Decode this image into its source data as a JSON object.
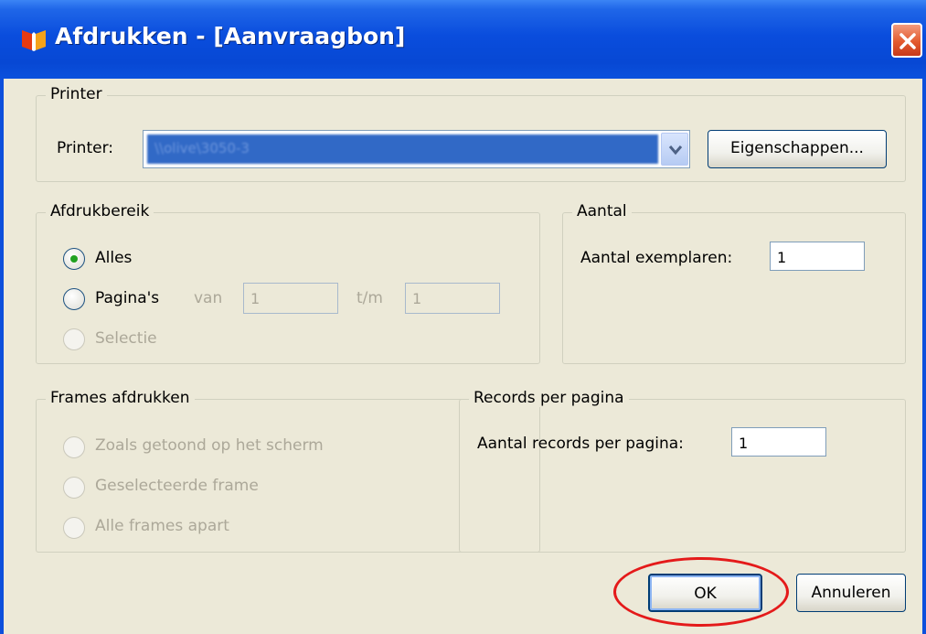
{
  "window": {
    "title": "Afdrukken - [Aanvraagbon]"
  },
  "printer_group": {
    "title": "Printer",
    "printer_label": "Printer:",
    "selected_printer": "\\\\olive\\3050-3",
    "properties_button": "Eigenschappen..."
  },
  "range_group": {
    "title": "Afdrukbereik",
    "options": [
      {
        "label": "Alles",
        "checked": true,
        "enabled": true
      },
      {
        "label": "Pagina's",
        "checked": false,
        "enabled": true
      },
      {
        "label": "Selectie",
        "checked": false,
        "enabled": false
      }
    ],
    "from_label": "van",
    "from_value": "1",
    "to_label": "t/m",
    "to_value": "1"
  },
  "count_group": {
    "title": "Aantal",
    "copies_label": "Aantal exemplaren:",
    "copies_value": "1"
  },
  "frames_group": {
    "title": "Frames afdrukken",
    "options": [
      {
        "label": "Zoals getoond op het scherm",
        "enabled": false
      },
      {
        "label": "Geselecteerde frame",
        "enabled": false
      },
      {
        "label": "Alle frames apart",
        "enabled": false
      }
    ]
  },
  "records_group": {
    "title": "Records per pagina",
    "records_label": "Aantal records per pagina:",
    "records_value": "1"
  },
  "buttons": {
    "ok": "OK",
    "cancel": "Annuleren"
  },
  "colors": {
    "titlebar": "#0a4ddd",
    "dialog_bg": "#ece9d8",
    "highlight_circle": "#e41a1a",
    "radio_checked_dot": "#21a121"
  }
}
